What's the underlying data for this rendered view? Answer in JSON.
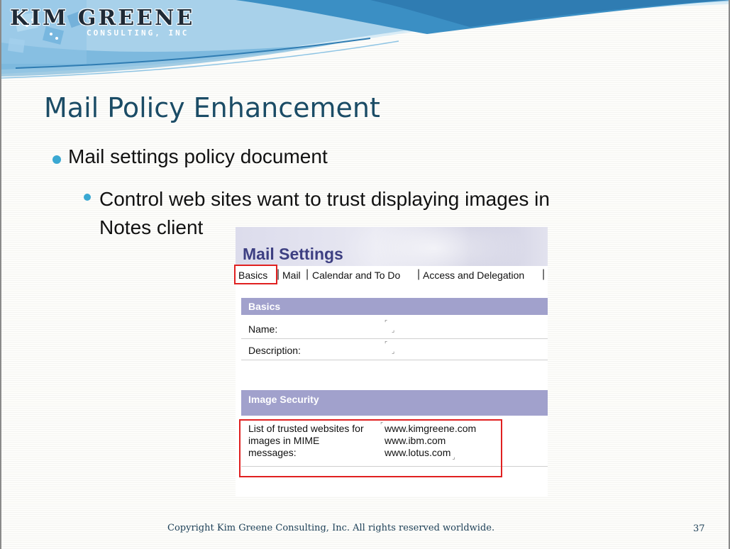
{
  "logo": {
    "name": "KIM GREENE",
    "sub": "CONSULTING, INC"
  },
  "slide": {
    "title": "Mail Policy Enhancement",
    "bullet1": "Mail settings policy document",
    "bullet2_line1": "Control web sites want to trust displaying images in",
    "bullet2_line2": "Notes client",
    "footer": "Copyright Kim Greene Consulting, Inc.  All rights reserved worldwide.",
    "page_number": "37"
  },
  "screenshot": {
    "title": "Mail Settings",
    "tabs": [
      "Basics",
      "Mail",
      "Calendar and To Do",
      "Access and Delegation"
    ],
    "basics_section": "Basics",
    "name_label": "Name:",
    "description_label": "Description:",
    "image_section": "Image Security",
    "trusted_label_lines": [
      "List of trusted websites for",
      "images in MIME",
      "messages:"
    ],
    "trusted_values": [
      "www.kimgreene.com",
      "www.ibm.com",
      "www.lotus.com"
    ]
  },
  "colors": {
    "title": "#1b4c66",
    "bullet": "#3aa8d2",
    "section_bar": "#a1a1cc",
    "highlight": "#e02020",
    "banner_blue": "#3b8fc4"
  }
}
